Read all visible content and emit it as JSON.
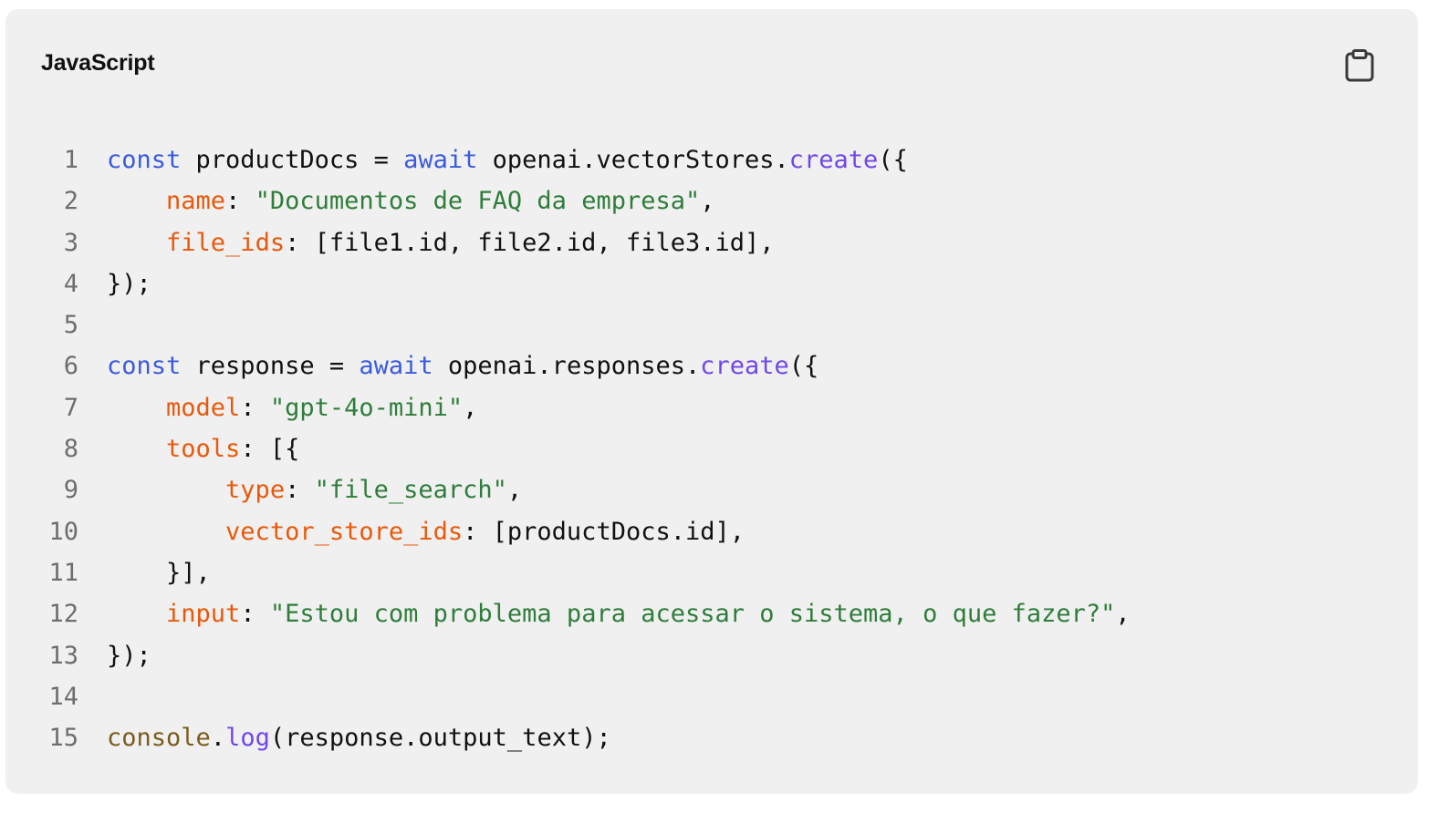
{
  "code_block": {
    "language": "JavaScript",
    "copy_icon": "clipboard-icon",
    "colors": {
      "background": "#f0f0f0",
      "keyword": "#3b5bdb",
      "function": "#7048e8",
      "property": "#e8590c",
      "string": "#2f7d3a",
      "object": "#7a5c1e",
      "plain": "#111111",
      "line_number": "#6e6e6e"
    },
    "lines": [
      {
        "n": "1",
        "tokens": [
          {
            "t": "const",
            "c": "kw"
          },
          {
            "t": " productDocs = ",
            "c": "pl"
          },
          {
            "t": "await",
            "c": "kw"
          },
          {
            "t": " openai.vectorStores.",
            "c": "pl"
          },
          {
            "t": "create",
            "c": "fn"
          },
          {
            "t": "({",
            "c": "pl"
          }
        ]
      },
      {
        "n": "2",
        "tokens": [
          {
            "t": "    ",
            "c": "pl"
          },
          {
            "t": "name",
            "c": "prop"
          },
          {
            "t": ": ",
            "c": "pl"
          },
          {
            "t": "\"Documentos de FAQ da empresa\"",
            "c": "str"
          },
          {
            "t": ",",
            "c": "pl"
          }
        ]
      },
      {
        "n": "3",
        "tokens": [
          {
            "t": "    ",
            "c": "pl"
          },
          {
            "t": "file_ids",
            "c": "prop"
          },
          {
            "t": ": [file1.id, file2.id, file3.id],",
            "c": "pl"
          }
        ]
      },
      {
        "n": "4",
        "tokens": [
          {
            "t": "});",
            "c": "pl"
          }
        ]
      },
      {
        "n": "5",
        "tokens": []
      },
      {
        "n": "6",
        "tokens": [
          {
            "t": "const",
            "c": "kw"
          },
          {
            "t": " response = ",
            "c": "pl"
          },
          {
            "t": "await",
            "c": "kw"
          },
          {
            "t": " openai.responses.",
            "c": "pl"
          },
          {
            "t": "create",
            "c": "fn"
          },
          {
            "t": "({",
            "c": "pl"
          }
        ]
      },
      {
        "n": "7",
        "tokens": [
          {
            "t": "    ",
            "c": "pl"
          },
          {
            "t": "model",
            "c": "prop"
          },
          {
            "t": ": ",
            "c": "pl"
          },
          {
            "t": "\"gpt-4o-mini\"",
            "c": "str"
          },
          {
            "t": ",",
            "c": "pl"
          }
        ]
      },
      {
        "n": "8",
        "tokens": [
          {
            "t": "    ",
            "c": "pl"
          },
          {
            "t": "tools",
            "c": "prop"
          },
          {
            "t": ": [{",
            "c": "pl"
          }
        ]
      },
      {
        "n": "9",
        "tokens": [
          {
            "t": "        ",
            "c": "pl"
          },
          {
            "t": "type",
            "c": "prop"
          },
          {
            "t": ": ",
            "c": "pl"
          },
          {
            "t": "\"file_search\"",
            "c": "str"
          },
          {
            "t": ",",
            "c": "pl"
          }
        ]
      },
      {
        "n": "10",
        "tokens": [
          {
            "t": "        ",
            "c": "pl"
          },
          {
            "t": "vector_store_ids",
            "c": "prop"
          },
          {
            "t": ": [productDocs.id],",
            "c": "pl"
          }
        ]
      },
      {
        "n": "11",
        "tokens": [
          {
            "t": "    }],",
            "c": "pl"
          }
        ]
      },
      {
        "n": "12",
        "tokens": [
          {
            "t": "    ",
            "c": "pl"
          },
          {
            "t": "input",
            "c": "prop"
          },
          {
            "t": ": ",
            "c": "pl"
          },
          {
            "t": "\"Estou com problema para acessar o sistema, o que fazer?\"",
            "c": "str"
          },
          {
            "t": ",",
            "c": "pl"
          }
        ]
      },
      {
        "n": "13",
        "tokens": [
          {
            "t": "});",
            "c": "pl"
          }
        ]
      },
      {
        "n": "14",
        "tokens": []
      },
      {
        "n": "15",
        "tokens": [
          {
            "t": "console",
            "c": "obj"
          },
          {
            "t": ".",
            "c": "pl"
          },
          {
            "t": "log",
            "c": "fn"
          },
          {
            "t": "(response.output_text);",
            "c": "pl"
          }
        ]
      }
    ]
  }
}
